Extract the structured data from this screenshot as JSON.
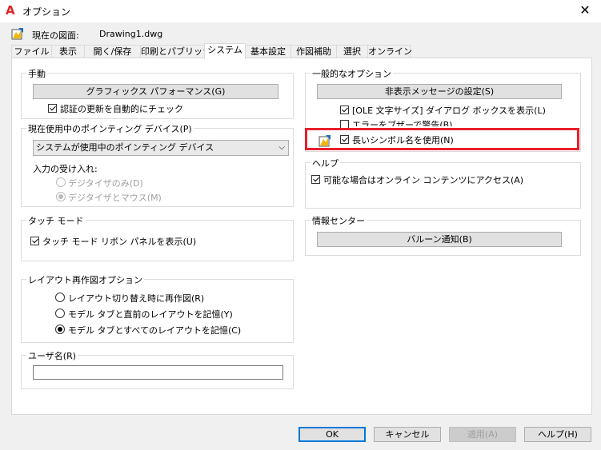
{
  "window": {
    "title": "オプション",
    "close_glyph": "✕",
    "app_icon_glyph": "A"
  },
  "header": {
    "current_drawing_label": "現在の図面:",
    "current_drawing_value": "Drawing1.dwg"
  },
  "tabs": [
    {
      "label": "ファイル"
    },
    {
      "label": "表示"
    },
    {
      "label": "開く/保存"
    },
    {
      "label": "印刷とパブリッシュ"
    },
    {
      "label": "システム"
    },
    {
      "label": "基本設定"
    },
    {
      "label": "作図補助"
    },
    {
      "label": "選択"
    },
    {
      "label": "オンライン"
    }
  ],
  "hardware": {
    "title": "手動",
    "graphics_button": "グラフィックス パフォーマンス(G)",
    "cert_check_label": "認証の更新を自動的にチェック"
  },
  "pointing": {
    "title": "現在使用中のポインティング デバイス(P)",
    "selected": "システムが使用中のポインティング デバイス",
    "input_label": "入力の受け入れ:",
    "radio_digitizer_only": "デジタイザのみ(D)",
    "radio_digitizer_mouse": "デジタイザとマウス(M)"
  },
  "touch": {
    "title": "タッチ モード",
    "show_ribbon_label": "タッチ モード リボン パネルを表示(U)"
  },
  "layout_regen": {
    "title": "レイアウト再作図オプション",
    "radio_regen_switch": "レイアウト切り替え時に再作図(R)",
    "radio_cache_model_last": "モデル タブと直前のレイアウトを記憶(Y)",
    "radio_cache_all": "モデル タブとすべてのレイアウトを記憶(C)"
  },
  "username": {
    "title": "ユーザ名(R)",
    "value": ""
  },
  "general": {
    "title": "一般的なオプション",
    "hidden_msg_button": "非表示メッセージの設定(S)",
    "ole_dialog_label": "[OLE 文字サイズ] ダイアログ ボックスを表示(L)",
    "beep_label": "エラーをブザーで警告(B)",
    "long_symbol_label": "長いシンボル名を使用(N)"
  },
  "help": {
    "title": "ヘルプ",
    "online_label": "可能な場合はオンライン コンテンツにアクセス(A)"
  },
  "info_center": {
    "title": "情報センター",
    "balloon_button": "バルーン通知(B)"
  },
  "footer": {
    "ok": "OK",
    "cancel": "キャンセル",
    "apply": "適用(A)",
    "help": "ヘルプ(H)"
  },
  "colors": {
    "highlight_border": "#e8202a",
    "default_button_border": "#0078d7"
  }
}
